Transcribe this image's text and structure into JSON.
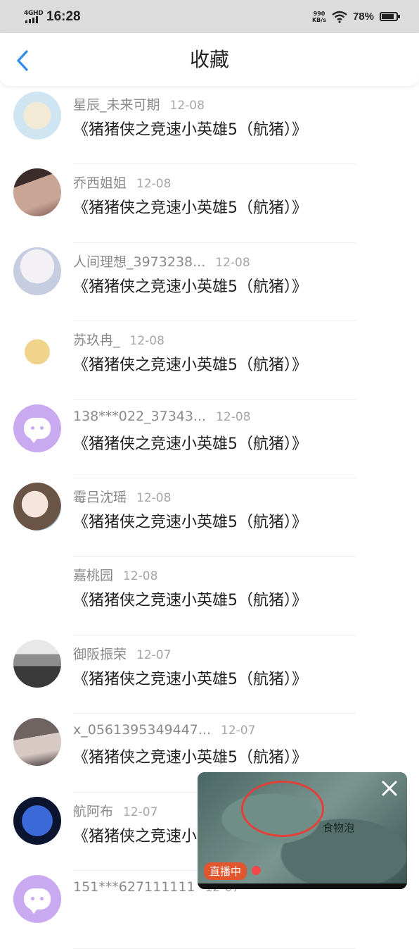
{
  "status_bar": {
    "network": "4GHD",
    "time": "16:28",
    "speed_value": "990",
    "speed_unit": "KB/s",
    "battery_percent": "78%",
    "battery_level": 0.78
  },
  "header": {
    "title": "收藏",
    "back_icon": "chevron-left-icon",
    "accent_color": "#2f8cf0"
  },
  "items": [
    {
      "user": "星辰_未来可期",
      "date": "12-08",
      "title": "《猪猪侠之竞速小英雄5（航猪）》",
      "avatar": "sheep"
    },
    {
      "user": "乔西姐姐",
      "date": "12-08",
      "title": "《猪猪侠之竞速小英雄5（航猪）》",
      "avatar": "girl"
    },
    {
      "user": "人间理想_3973238...",
      "date": "12-08",
      "title": "《猪猪侠之竞速小英雄5（航猪）》",
      "avatar": "anime"
    },
    {
      "user": "苏玖冉_",
      "date": "12-08",
      "title": "《猪猪侠之竞速小英雄5（航猪）》",
      "avatar": "boy"
    },
    {
      "user": "138***022_37343...",
      "date": "12-08",
      "title": "《猪猪侠之竞速小英雄5（航猪）》",
      "avatar": "purple"
    },
    {
      "user": "霉吕沈瑶",
      "date": "12-08",
      "title": "《猪猪侠之竞速小英雄5（航猪）》",
      "avatar": "anime2"
    },
    {
      "user": "嘉桃园",
      "date": "12-08",
      "title": "《猪猪侠之竞速小英雄5（航猪）》",
      "avatar": "none"
    },
    {
      "user": "御阪振荣",
      "date": "12-07",
      "title": "《猪猪侠之竞速小英雄5（航猪）》",
      "avatar": "bw"
    },
    {
      "user": "x_0561395349447...",
      "date": "12-07",
      "title": "《猪猪侠之竞速小英雄5（航猪）》",
      "avatar": "girl2"
    },
    {
      "user": "航阿布",
      "date": "12-07",
      "title": "《猪猪侠之竞速小英雄5（航猪）》",
      "avatar": "blue"
    },
    {
      "user": "151***627111111",
      "date": "12-07",
      "title": "",
      "avatar": "purple"
    }
  ],
  "floating_video": {
    "caption": "食物泡",
    "live_label": "直播中",
    "close_icon": "close-icon"
  }
}
